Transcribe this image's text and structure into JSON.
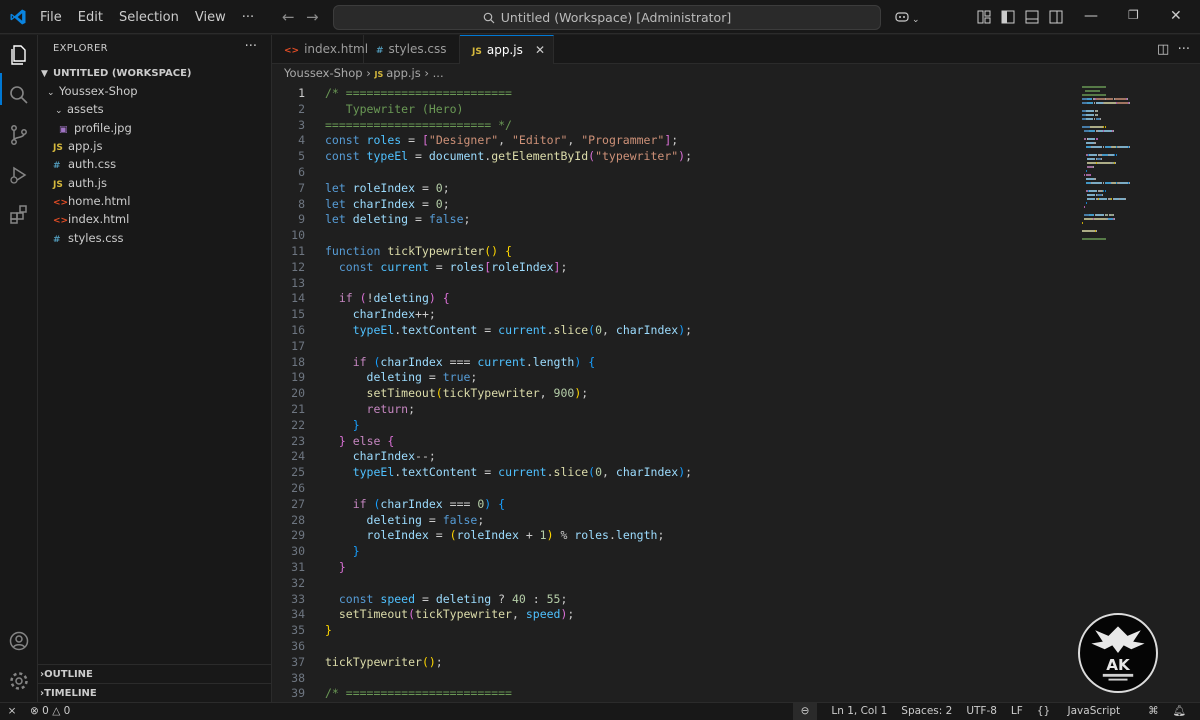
{
  "menu": [
    "File",
    "Edit",
    "Selection",
    "View",
    "···"
  ],
  "command_center": "Untitled (Workspace) [Administrator]",
  "sidebar": {
    "header": "EXPLORER",
    "more": "···",
    "workspace": "UNTITLED (WORKSPACE)",
    "folder": "Youssex-Shop",
    "tree": [
      {
        "name": "assets",
        "kind": "folder",
        "icon": ""
      },
      {
        "name": "profile.jpg",
        "kind": "img",
        "icon": "▣"
      },
      {
        "name": "app.js",
        "kind": "js",
        "icon": "JS"
      },
      {
        "name": "auth.css",
        "kind": "css",
        "icon": "#"
      },
      {
        "name": "auth.js",
        "kind": "js",
        "icon": "JS"
      },
      {
        "name": "home.html",
        "kind": "html",
        "icon": "<>"
      },
      {
        "name": "index.html",
        "kind": "html",
        "icon": "<>"
      },
      {
        "name": "styles.css",
        "kind": "css",
        "icon": "#"
      }
    ],
    "outline": "OUTLINE",
    "timeline": "TIMELINE"
  },
  "tabs": [
    {
      "label": "index.html",
      "icon": "<>",
      "kind": "html"
    },
    {
      "label": "styles.css",
      "icon": "#",
      "kind": "css"
    },
    {
      "label": "app.js",
      "icon": "JS",
      "kind": "js",
      "active": true
    }
  ],
  "breadcrumb": {
    "folder": "Youssex-Shop",
    "file": "app.js",
    "rest": "..."
  },
  "code": [
    [
      [
        "c",
        "/* ========================"
      ]
    ],
    [
      [
        "c",
        "   Typewriter (Hero)"
      ]
    ],
    [
      [
        "c",
        "======================== */"
      ]
    ],
    [
      [
        "k",
        "const "
      ],
      [
        "cst",
        "roles"
      ],
      [
        "p",
        " = "
      ],
      [
        "b2",
        "["
      ],
      [
        "s",
        "\"Designer\""
      ],
      [
        "p",
        ", "
      ],
      [
        "s",
        "\"Editor\""
      ],
      [
        "p",
        ", "
      ],
      [
        "s",
        "\"Programmer\""
      ],
      [
        "b2",
        "]"
      ],
      [
        "p",
        ";"
      ]
    ],
    [
      [
        "k",
        "const "
      ],
      [
        "cst",
        "typeEl"
      ],
      [
        "p",
        " = "
      ],
      [
        "v",
        "document"
      ],
      [
        "p",
        "."
      ],
      [
        "f",
        "getElementById"
      ],
      [
        "b2",
        "("
      ],
      [
        "s",
        "\"typewriter\""
      ],
      [
        "b2",
        ")"
      ],
      [
        "p",
        ";"
      ]
    ],
    [],
    [
      [
        "k",
        "let "
      ],
      [
        "v",
        "roleIndex"
      ],
      [
        "p",
        " = "
      ],
      [
        "n",
        "0"
      ],
      [
        "p",
        ";"
      ]
    ],
    [
      [
        "k",
        "let "
      ],
      [
        "v",
        "charIndex"
      ],
      [
        "p",
        " = "
      ],
      [
        "n",
        "0"
      ],
      [
        "p",
        ";"
      ]
    ],
    [
      [
        "k",
        "let "
      ],
      [
        "v",
        "deleting"
      ],
      [
        "p",
        " = "
      ],
      [
        "k",
        "false"
      ],
      [
        "p",
        ";"
      ]
    ],
    [],
    [
      [
        "k",
        "function "
      ],
      [
        "f",
        "tickTypewriter"
      ],
      [
        "b1",
        "()"
      ],
      [
        "p",
        " "
      ],
      [
        "b1",
        "{"
      ]
    ],
    [
      [
        "p",
        "  "
      ],
      [
        "k",
        "const "
      ],
      [
        "cst",
        "current"
      ],
      [
        "p",
        " = "
      ],
      [
        "v",
        "roles"
      ],
      [
        "b2",
        "["
      ],
      [
        "v",
        "roleIndex"
      ],
      [
        "b2",
        "]"
      ],
      [
        "p",
        ";"
      ]
    ],
    [],
    [
      [
        "p",
        "  "
      ],
      [
        "kc",
        "if "
      ],
      [
        "b2",
        "("
      ],
      [
        "p",
        "!"
      ],
      [
        "v",
        "deleting"
      ],
      [
        "b2",
        ")"
      ],
      [
        "p",
        " "
      ],
      [
        "b2",
        "{"
      ]
    ],
    [
      [
        "p",
        "    "
      ],
      [
        "v",
        "charIndex"
      ],
      [
        "p",
        "++;"
      ]
    ],
    [
      [
        "p",
        "    "
      ],
      [
        "cst",
        "typeEl"
      ],
      [
        "p",
        "."
      ],
      [
        "v",
        "textContent"
      ],
      [
        "p",
        " = "
      ],
      [
        "cst",
        "current"
      ],
      [
        "p",
        "."
      ],
      [
        "f",
        "slice"
      ],
      [
        "b3",
        "("
      ],
      [
        "n",
        "0"
      ],
      [
        "p",
        ", "
      ],
      [
        "v",
        "charIndex"
      ],
      [
        "b3",
        ")"
      ],
      [
        "p",
        ";"
      ]
    ],
    [],
    [
      [
        "p",
        "    "
      ],
      [
        "kc",
        "if "
      ],
      [
        "b3",
        "("
      ],
      [
        "v",
        "charIndex"
      ],
      [
        "p",
        " === "
      ],
      [
        "cst",
        "current"
      ],
      [
        "p",
        "."
      ],
      [
        "v",
        "length"
      ],
      [
        "b3",
        ")"
      ],
      [
        "p",
        " "
      ],
      [
        "b3",
        "{"
      ]
    ],
    [
      [
        "p",
        "      "
      ],
      [
        "v",
        "deleting"
      ],
      [
        "p",
        " = "
      ],
      [
        "k",
        "true"
      ],
      [
        "p",
        ";"
      ]
    ],
    [
      [
        "p",
        "      "
      ],
      [
        "f",
        "setTimeout"
      ],
      [
        "b1",
        "("
      ],
      [
        "f",
        "tickTypewriter"
      ],
      [
        "p",
        ", "
      ],
      [
        "n",
        "900"
      ],
      [
        "b1",
        ")"
      ],
      [
        "p",
        ";"
      ]
    ],
    [
      [
        "p",
        "      "
      ],
      [
        "kc",
        "return"
      ],
      [
        "p",
        ";"
      ]
    ],
    [
      [
        "p",
        "    "
      ],
      [
        "b3",
        "}"
      ]
    ],
    [
      [
        "p",
        "  "
      ],
      [
        "b2",
        "}"
      ],
      [
        "kc",
        " else "
      ],
      [
        "b2",
        "{"
      ]
    ],
    [
      [
        "p",
        "    "
      ],
      [
        "v",
        "charIndex"
      ],
      [
        "p",
        "--;"
      ]
    ],
    [
      [
        "p",
        "    "
      ],
      [
        "cst",
        "typeEl"
      ],
      [
        "p",
        "."
      ],
      [
        "v",
        "textContent"
      ],
      [
        "p",
        " = "
      ],
      [
        "cst",
        "current"
      ],
      [
        "p",
        "."
      ],
      [
        "f",
        "slice"
      ],
      [
        "b3",
        "("
      ],
      [
        "n",
        "0"
      ],
      [
        "p",
        ", "
      ],
      [
        "v",
        "charIndex"
      ],
      [
        "b3",
        ")"
      ],
      [
        "p",
        ";"
      ]
    ],
    [],
    [
      [
        "p",
        "    "
      ],
      [
        "kc",
        "if "
      ],
      [
        "b3",
        "("
      ],
      [
        "v",
        "charIndex"
      ],
      [
        "p",
        " === "
      ],
      [
        "n",
        "0"
      ],
      [
        "b3",
        ")"
      ],
      [
        "p",
        " "
      ],
      [
        "b3",
        "{"
      ]
    ],
    [
      [
        "p",
        "      "
      ],
      [
        "v",
        "deleting"
      ],
      [
        "p",
        " = "
      ],
      [
        "k",
        "false"
      ],
      [
        "p",
        ";"
      ]
    ],
    [
      [
        "p",
        "      "
      ],
      [
        "v",
        "roleIndex"
      ],
      [
        "p",
        " = "
      ],
      [
        "b1",
        "("
      ],
      [
        "v",
        "roleIndex"
      ],
      [
        "p",
        " + "
      ],
      [
        "n",
        "1"
      ],
      [
        "b1",
        ")"
      ],
      [
        "p",
        " % "
      ],
      [
        "v",
        "roles"
      ],
      [
        "p",
        "."
      ],
      [
        "v",
        "length"
      ],
      [
        "p",
        ";"
      ]
    ],
    [
      [
        "p",
        "    "
      ],
      [
        "b3",
        "}"
      ]
    ],
    [
      [
        "p",
        "  "
      ],
      [
        "b2",
        "}"
      ]
    ],
    [],
    [
      [
        "p",
        "  "
      ],
      [
        "k",
        "const "
      ],
      [
        "cst",
        "speed"
      ],
      [
        "p",
        " = "
      ],
      [
        "v",
        "deleting"
      ],
      [
        "p",
        " ? "
      ],
      [
        "n",
        "40"
      ],
      [
        "p",
        " : "
      ],
      [
        "n",
        "55"
      ],
      [
        "p",
        ";"
      ]
    ],
    [
      [
        "p",
        "  "
      ],
      [
        "f",
        "setTimeout"
      ],
      [
        "b2",
        "("
      ],
      [
        "f",
        "tickTypewriter"
      ],
      [
        "p",
        ", "
      ],
      [
        "cst",
        "speed"
      ],
      [
        "b2",
        ")"
      ],
      [
        "p",
        ";"
      ]
    ],
    [
      [
        "b1",
        "}"
      ]
    ],
    [],
    [
      [
        "f",
        "tickTypewriter"
      ],
      [
        "b1",
        "()"
      ],
      [
        "p",
        ";"
      ]
    ],
    [],
    [
      [
        "c",
        "/* ========================"
      ]
    ]
  ],
  "statusbar": {
    "errors": "0",
    "warnings": "0",
    "position": "Ln 1, Col 1",
    "spaces": "Spaces: 2",
    "encoding": "UTF-8",
    "eol": "LF",
    "language": "JavaScript"
  },
  "colors": {
    "accent": "#0078d4",
    "editor_bg": "#1f1f1f",
    "chrome_bg": "#181818"
  }
}
